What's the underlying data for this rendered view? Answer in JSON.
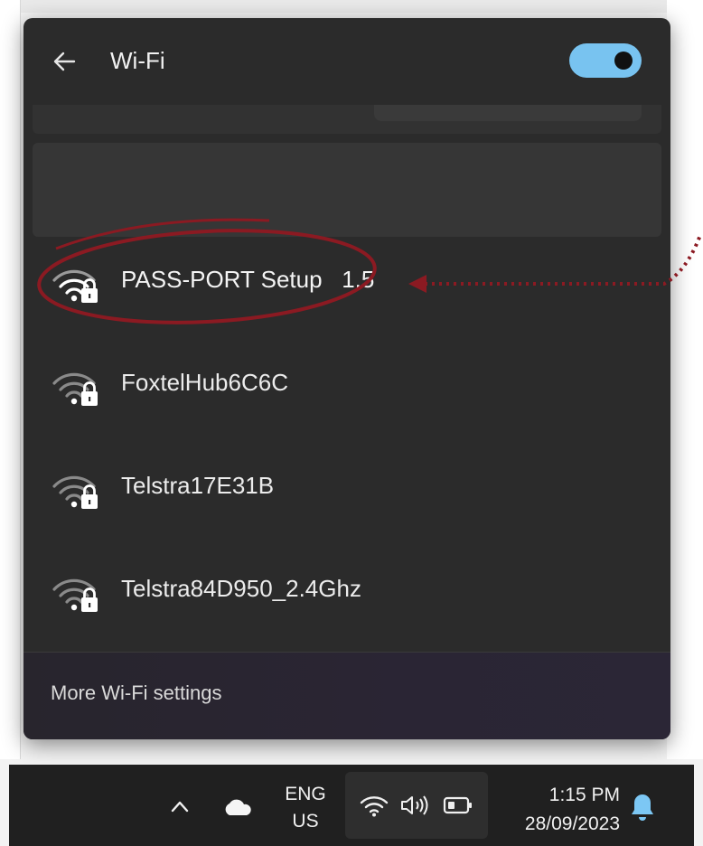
{
  "flyout": {
    "title": "Wi-Fi",
    "wifi_enabled": true
  },
  "networks": [
    {
      "name": "PASS-PORT Setup   1.5",
      "secured": true,
      "highlighted": true
    },
    {
      "name": "FoxtelHub6C6C",
      "secured": true,
      "highlighted": false
    },
    {
      "name": "Telstra17E31B",
      "secured": true,
      "highlighted": false
    },
    {
      "name": "Telstra84D950_2.4Ghz",
      "secured": true,
      "highlighted": false
    }
  ],
  "footer": {
    "settings_link": "More Wi-Fi settings"
  },
  "taskbar": {
    "lang_line1": "ENG",
    "lang_line2": "US",
    "time": "1:15 PM",
    "date": "28/09/2023"
  },
  "icons": {
    "back": "back-arrow-icon",
    "wifi_secured": "wifi-lock-icon",
    "overflow": "chevron-up-icon",
    "cloud": "onedrive-cloud-icon",
    "tray_wifi": "wifi-icon",
    "tray_volume": "speaker-icon",
    "tray_battery": "battery-icon",
    "notifications": "bell-icon"
  },
  "colors": {
    "toggle_on": "#78c3f0",
    "annotation": "#8b1a22",
    "bell": "#7cc7f4"
  }
}
